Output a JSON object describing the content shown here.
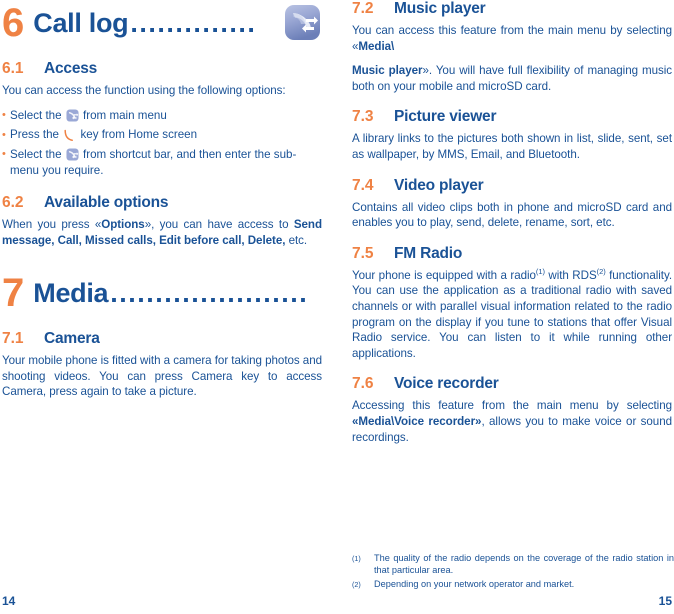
{
  "colors": {
    "heading_blue": "#1a5296",
    "accent_orange": "#ef8244",
    "icon_blue_light": "#b9c4e4",
    "icon_blue_dark": "#6d7fba"
  },
  "left_column": {
    "chapter": {
      "number": "6",
      "title": "Call log",
      "leader": "..............",
      "icon": "call-log-icon"
    },
    "sections": [
      {
        "number": "6.1",
        "name": "Access",
        "intro": "You can access the function using the following options:",
        "bullets": [
          {
            "pre": "Select the",
            "icon": "call-log-small-icon",
            "post": "from main menu"
          },
          {
            "pre": "Press the",
            "icon": "call-key-icon",
            "post": "key from Home screen"
          },
          {
            "pre": "Select the",
            "icon": "call-log-small-icon",
            "post": "from shortcut bar, and then enter the sub-menu you require."
          }
        ]
      },
      {
        "number": "6.2",
        "name": "Available options",
        "paragraph_parts": [
          {
            "text": "When you press «",
            "bold": false
          },
          {
            "text": "Options",
            "bold": true
          },
          {
            "text": "», you can have access to ",
            "bold": false
          },
          {
            "text": "Send message, Call, Missed calls, Edit before call, Delete,",
            "bold": true
          },
          {
            "text": " etc.",
            "bold": false
          }
        ]
      }
    ],
    "chapter2": {
      "number": "7",
      "title": "Media",
      "leader": "......................"
    },
    "sections2": [
      {
        "number": "7.1",
        "name": "Camera",
        "paragraph": "Your mobile phone is fitted with a camera for taking photos and shooting videos. You can press Camera key to access Camera, press again to take a picture."
      }
    ],
    "page_number": "14"
  },
  "right_column": {
    "sections": [
      {
        "number": "7.2",
        "name": "Music player",
        "paragraphs": [
          [
            {
              "text": "You can access this feature from the main menu by selecting «",
              "bold": false
            },
            {
              "text": "Media\\",
              "bold": true
            }
          ],
          [
            {
              "text": "Music player",
              "bold": true
            },
            {
              "text": "». You will have full flexibility of managing music both on your mobile and microSD card.",
              "bold": false
            }
          ]
        ]
      },
      {
        "number": "7.3",
        "name": "Picture viewer",
        "paragraphs": [
          [
            {
              "text": "A library links to the pictures both shown in list, slide, sent, set as wallpaper, by MMS, Email, and Bluetooth.",
              "bold": false
            }
          ]
        ]
      },
      {
        "number": "7.4",
        "name": "Video player",
        "paragraphs": [
          [
            {
              "text": "Contains all video clips both in phone and microSD card and enables you to play, send, delete, rename, sort, etc.",
              "bold": false
            }
          ]
        ]
      },
      {
        "number": "7.5",
        "name": "FM Radio",
        "paragraphs": [
          [
            {
              "text": "Your phone is equipped with a radio",
              "bold": false
            },
            {
              "sup": "(1)"
            },
            {
              "text": " with RDS",
              "bold": false
            },
            {
              "sup": "(2)"
            },
            {
              "text": " functionality. You can use the application as a traditional radio with saved channels or with parallel visual information related to the radio program on the display if you tune to stations that offer Visual Radio service. You can listen to it while running other applications.",
              "bold": false
            }
          ]
        ]
      },
      {
        "number": "7.6",
        "name": "Voice recorder",
        "paragraphs": [
          [
            {
              "text": "Accessing this feature from the main menu by selecting ",
              "bold": false
            },
            {
              "text": "«Media\\Voice recorder»",
              "bold": true
            },
            {
              "text": ", allows you to make voice or sound recordings.",
              "bold": false
            }
          ]
        ]
      }
    ],
    "footnotes": [
      {
        "mark": "(1)",
        "text": "The quality of the radio depends on the coverage of the radio station in that particular area."
      },
      {
        "mark": "(2)",
        "text": "Depending on your network operator and market."
      }
    ],
    "page_number": "15"
  }
}
